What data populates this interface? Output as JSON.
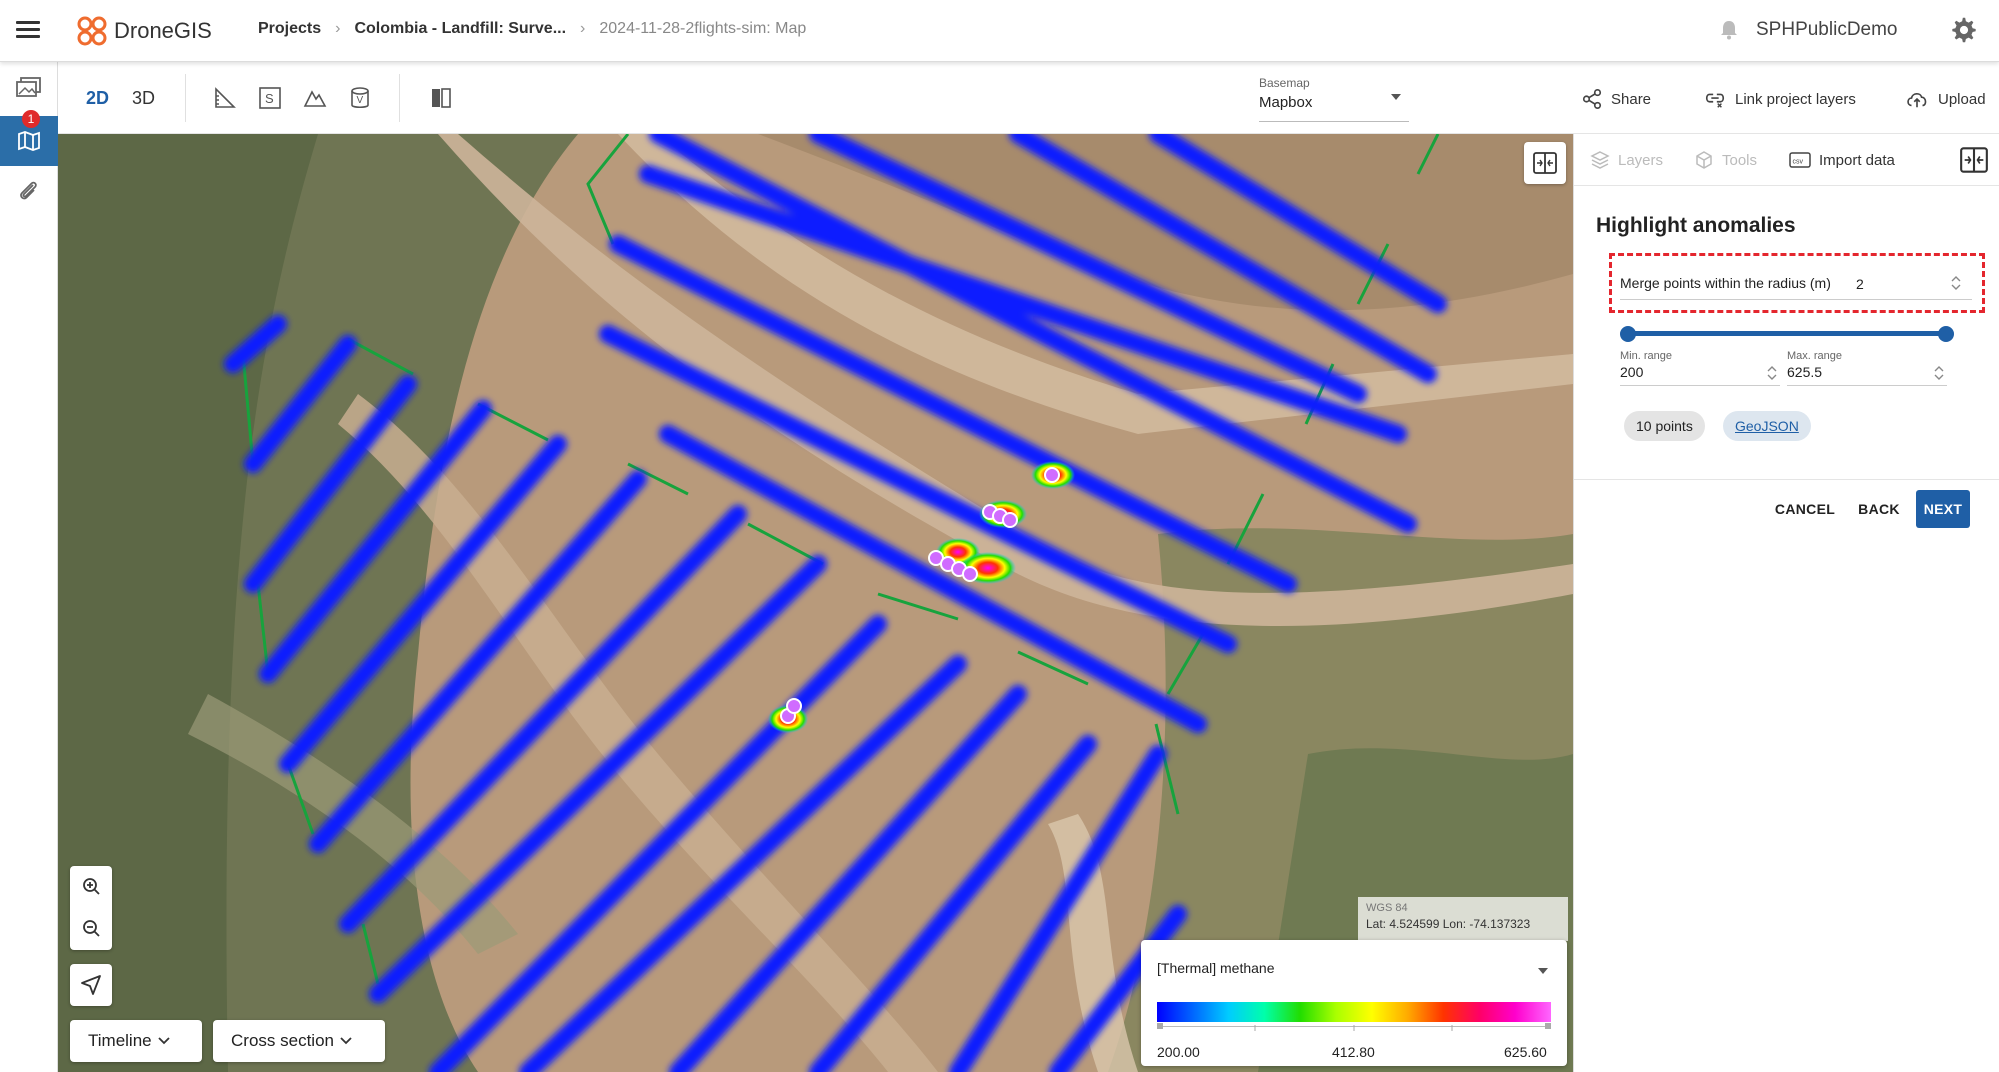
{
  "header": {
    "app_name": "DroneGIS",
    "breadcrumb": [
      "Projects",
      "Colombia - Landfill: Surve...",
      "2024-11-28-2flights-sim: Map"
    ],
    "user": "SPHPublicDemo"
  },
  "left_rail": {
    "items": [
      "gallery",
      "map",
      "attachments"
    ],
    "badge_count": "1"
  },
  "toolbar": {
    "mode_2d": "2D",
    "mode_3d": "3D",
    "basemap_label": "Basemap",
    "basemap_value": "Mapbox",
    "share": "Share",
    "link_layers": "Link project layers",
    "upload": "Upload"
  },
  "map": {
    "crs": "WGS 84",
    "lat_lon": "Lat: 4.524599   Lon: -74.137323",
    "timeline": "Timeline",
    "cross_section": "Cross section",
    "legend": {
      "layer": "[Thermal] methane",
      "min": "200.00",
      "mid": "412.80",
      "max": "625.60"
    }
  },
  "panel": {
    "tabs": [
      "Layers",
      "Tools",
      "Import data"
    ],
    "title": "Highlight anomalies",
    "merge_label": "Merge points within the radius (m)",
    "merge_value": "2",
    "min_label": "Min. range",
    "min_value": "200",
    "max_label": "Max. range",
    "max_value": "625.5",
    "slider": {
      "min": 200,
      "max": 625.6,
      "low": 200,
      "high": 625.5
    },
    "points_chip": "10 points",
    "geojson_chip": "GeoJSON",
    "cancel": "CANCEL",
    "back": "BACK",
    "next": "NEXT"
  },
  "colors": {
    "primary": "#1f5fa6",
    "highlight": "#e4262e",
    "flight_path": "#0a1aff"
  }
}
